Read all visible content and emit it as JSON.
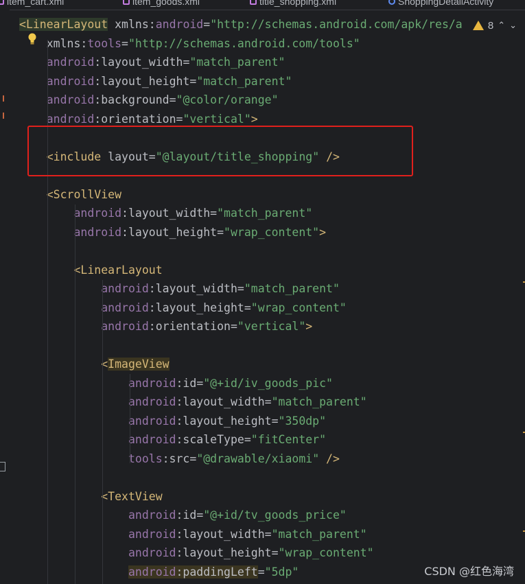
{
  "tabs": [
    {
      "label": "item_cart.xml",
      "icon": "xml-file-icon"
    },
    {
      "label": "item_goods.xml",
      "icon": "xml-file-icon"
    },
    {
      "label": "title_shopping.xml",
      "icon": "xml-file-icon"
    },
    {
      "label": "ShoppingDetailActivity",
      "icon": "class-icon"
    }
  ],
  "inspections": {
    "warning_count": "8"
  },
  "code_lines": [
    {
      "tokens": [
        {
          "t": "<",
          "c": "hl-open"
        },
        {
          "t": "LinearLayout",
          "c": "hl-open"
        },
        {
          "t": " xmlns:",
          "c": "t-attr"
        },
        {
          "t": "android",
          "c": "t-ns"
        },
        {
          "t": "=",
          "c": "t-plain"
        },
        {
          "t": "\"http://schemas.android.com/apk/res/a",
          "c": "t-str"
        }
      ]
    },
    {
      "tokens": [
        {
          "t": "    xmlns:",
          "c": "t-attr"
        },
        {
          "t": "tools",
          "c": "t-ns"
        },
        {
          "t": "=",
          "c": "t-plain"
        },
        {
          "t": "\"http://schemas.android.com/tools\"",
          "c": "t-str"
        }
      ]
    },
    {
      "tokens": [
        {
          "t": "    ",
          "c": "t-plain"
        },
        {
          "t": "android",
          "c": "t-ns"
        },
        {
          "t": ":layout_width",
          "c": "t-attr"
        },
        {
          "t": "=",
          "c": "t-plain"
        },
        {
          "t": "\"match_parent\"",
          "c": "t-str"
        }
      ]
    },
    {
      "tokens": [
        {
          "t": "    ",
          "c": "t-plain"
        },
        {
          "t": "android",
          "c": "t-ns"
        },
        {
          "t": ":layout_height",
          "c": "t-attr"
        },
        {
          "t": "=",
          "c": "t-plain"
        },
        {
          "t": "\"match_parent\"",
          "c": "t-str"
        }
      ]
    },
    {
      "tokens": [
        {
          "t": "    ",
          "c": "t-plain"
        },
        {
          "t": "android",
          "c": "t-ns"
        },
        {
          "t": ":background",
          "c": "t-attr"
        },
        {
          "t": "=",
          "c": "t-plain"
        },
        {
          "t": "\"@color/orange\"",
          "c": "t-str"
        }
      ]
    },
    {
      "tokens": [
        {
          "t": "    ",
          "c": "t-plain"
        },
        {
          "t": "android",
          "c": "t-ns"
        },
        {
          "t": ":orientation",
          "c": "t-attr"
        },
        {
          "t": "=",
          "c": "t-plain"
        },
        {
          "t": "\"vertical\"",
          "c": "t-str"
        },
        {
          "t": ">",
          "c": "t-lt"
        }
      ]
    },
    {
      "tokens": []
    },
    {
      "tokens": [
        {
          "t": "    ",
          "c": "t-plain"
        },
        {
          "t": "<include",
          "c": "t-tag"
        },
        {
          "t": " layout",
          "c": "t-attr"
        },
        {
          "t": "=",
          "c": "t-plain"
        },
        {
          "t": "\"@layout/title_shopping\"",
          "c": "t-str"
        },
        {
          "t": " />",
          "c": "t-lt"
        }
      ]
    },
    {
      "tokens": []
    },
    {
      "tokens": [
        {
          "t": "    ",
          "c": "t-plain"
        },
        {
          "t": "<ScrollView",
          "c": "t-tag"
        }
      ]
    },
    {
      "tokens": [
        {
          "t": "        ",
          "c": "t-plain"
        },
        {
          "t": "android",
          "c": "t-ns"
        },
        {
          "t": ":layout_width",
          "c": "t-attr"
        },
        {
          "t": "=",
          "c": "t-plain"
        },
        {
          "t": "\"match_parent\"",
          "c": "t-str"
        }
      ]
    },
    {
      "tokens": [
        {
          "t": "        ",
          "c": "t-plain"
        },
        {
          "t": "android",
          "c": "t-ns"
        },
        {
          "t": ":layout_height",
          "c": "t-attr"
        },
        {
          "t": "=",
          "c": "t-plain"
        },
        {
          "t": "\"wrap_content\"",
          "c": "t-str"
        },
        {
          "t": ">",
          "c": "t-lt"
        }
      ]
    },
    {
      "tokens": []
    },
    {
      "tokens": [
        {
          "t": "        ",
          "c": "t-plain"
        },
        {
          "t": "<LinearLayout",
          "c": "t-tag"
        }
      ]
    },
    {
      "tokens": [
        {
          "t": "            ",
          "c": "t-plain"
        },
        {
          "t": "android",
          "c": "t-ns"
        },
        {
          "t": ":layout_width",
          "c": "t-attr"
        },
        {
          "t": "=",
          "c": "t-plain"
        },
        {
          "t": "\"match_parent\"",
          "c": "t-str"
        }
      ]
    },
    {
      "tokens": [
        {
          "t": "            ",
          "c": "t-plain"
        },
        {
          "t": "android",
          "c": "t-ns"
        },
        {
          "t": ":layout_height",
          "c": "t-attr"
        },
        {
          "t": "=",
          "c": "t-plain"
        },
        {
          "t": "\"wrap_content\"",
          "c": "t-str"
        }
      ]
    },
    {
      "tokens": [
        {
          "t": "            ",
          "c": "t-plain"
        },
        {
          "t": "android",
          "c": "t-ns"
        },
        {
          "t": ":orientation",
          "c": "t-attr"
        },
        {
          "t": "=",
          "c": "t-plain"
        },
        {
          "t": "\"vertical\"",
          "c": "t-str"
        },
        {
          "t": ">",
          "c": "t-lt"
        }
      ]
    },
    {
      "tokens": []
    },
    {
      "tokens": [
        {
          "t": "            ",
          "c": "t-plain"
        },
        {
          "t": "<",
          "c": "t-lt"
        },
        {
          "t": "ImageView",
          "c": "t-tag hl-tag"
        }
      ]
    },
    {
      "tokens": [
        {
          "t": "                ",
          "c": "t-plain"
        },
        {
          "t": "android",
          "c": "t-ns"
        },
        {
          "t": ":id",
          "c": "t-attr"
        },
        {
          "t": "=",
          "c": "t-plain"
        },
        {
          "t": "\"@+id/iv_goods_pic\"",
          "c": "t-str"
        }
      ]
    },
    {
      "tokens": [
        {
          "t": "                ",
          "c": "t-plain"
        },
        {
          "t": "android",
          "c": "t-ns"
        },
        {
          "t": ":layout_width",
          "c": "t-attr"
        },
        {
          "t": "=",
          "c": "t-plain"
        },
        {
          "t": "\"match_parent\"",
          "c": "t-str"
        }
      ]
    },
    {
      "tokens": [
        {
          "t": "                ",
          "c": "t-plain"
        },
        {
          "t": "android",
          "c": "t-ns"
        },
        {
          "t": ":layout_height",
          "c": "t-attr"
        },
        {
          "t": "=",
          "c": "t-plain"
        },
        {
          "t": "\"350dp\"",
          "c": "t-str"
        }
      ]
    },
    {
      "tokens": [
        {
          "t": "                ",
          "c": "t-plain"
        },
        {
          "t": "android",
          "c": "t-ns"
        },
        {
          "t": ":scaleType",
          "c": "t-attr"
        },
        {
          "t": "=",
          "c": "t-plain"
        },
        {
          "t": "\"fitCenter\"",
          "c": "t-str"
        }
      ]
    },
    {
      "tokens": [
        {
          "t": "                ",
          "c": "t-plain"
        },
        {
          "t": "tools",
          "c": "t-ns"
        },
        {
          "t": ":src",
          "c": "t-attr"
        },
        {
          "t": "=",
          "c": "t-plain"
        },
        {
          "t": "\"@drawable/xiaomi\"",
          "c": "t-str"
        },
        {
          "t": " />",
          "c": "t-lt"
        }
      ]
    },
    {
      "tokens": []
    },
    {
      "tokens": [
        {
          "t": "            ",
          "c": "t-plain"
        },
        {
          "t": "<TextView",
          "c": "t-tag"
        }
      ]
    },
    {
      "tokens": [
        {
          "t": "                ",
          "c": "t-plain"
        },
        {
          "t": "android",
          "c": "t-ns"
        },
        {
          "t": ":id",
          "c": "t-attr"
        },
        {
          "t": "=",
          "c": "t-plain"
        },
        {
          "t": "\"@+id/tv_goods_price\"",
          "c": "t-str"
        }
      ]
    },
    {
      "tokens": [
        {
          "t": "                ",
          "c": "t-plain"
        },
        {
          "t": "android",
          "c": "t-ns"
        },
        {
          "t": ":layout_width",
          "c": "t-attr"
        },
        {
          "t": "=",
          "c": "t-plain"
        },
        {
          "t": "\"match_parent\"",
          "c": "t-str"
        }
      ]
    },
    {
      "tokens": [
        {
          "t": "                ",
          "c": "t-plain"
        },
        {
          "t": "android",
          "c": "t-ns"
        },
        {
          "t": ":layout_height",
          "c": "t-attr"
        },
        {
          "t": "=",
          "c": "t-plain"
        },
        {
          "t": "\"wrap_content\"",
          "c": "t-str"
        }
      ]
    },
    {
      "tokens": [
        {
          "t": "                ",
          "c": "t-plain"
        },
        {
          "t": "android",
          "c": "t-ns hl-attr"
        },
        {
          "t": ":paddingLeft",
          "c": "t-attr hl-attr"
        },
        {
          "t": "=",
          "c": "t-plain"
        },
        {
          "t": "\"5dp\"",
          "c": "t-str"
        }
      ]
    }
  ],
  "watermark": "CSDN @红色海湾",
  "colors": {
    "background": "#1e1f22",
    "tag": "#d5b778",
    "namespace": "#9876aa",
    "string": "#6aab73",
    "highlight_box": "#e0201c"
  }
}
